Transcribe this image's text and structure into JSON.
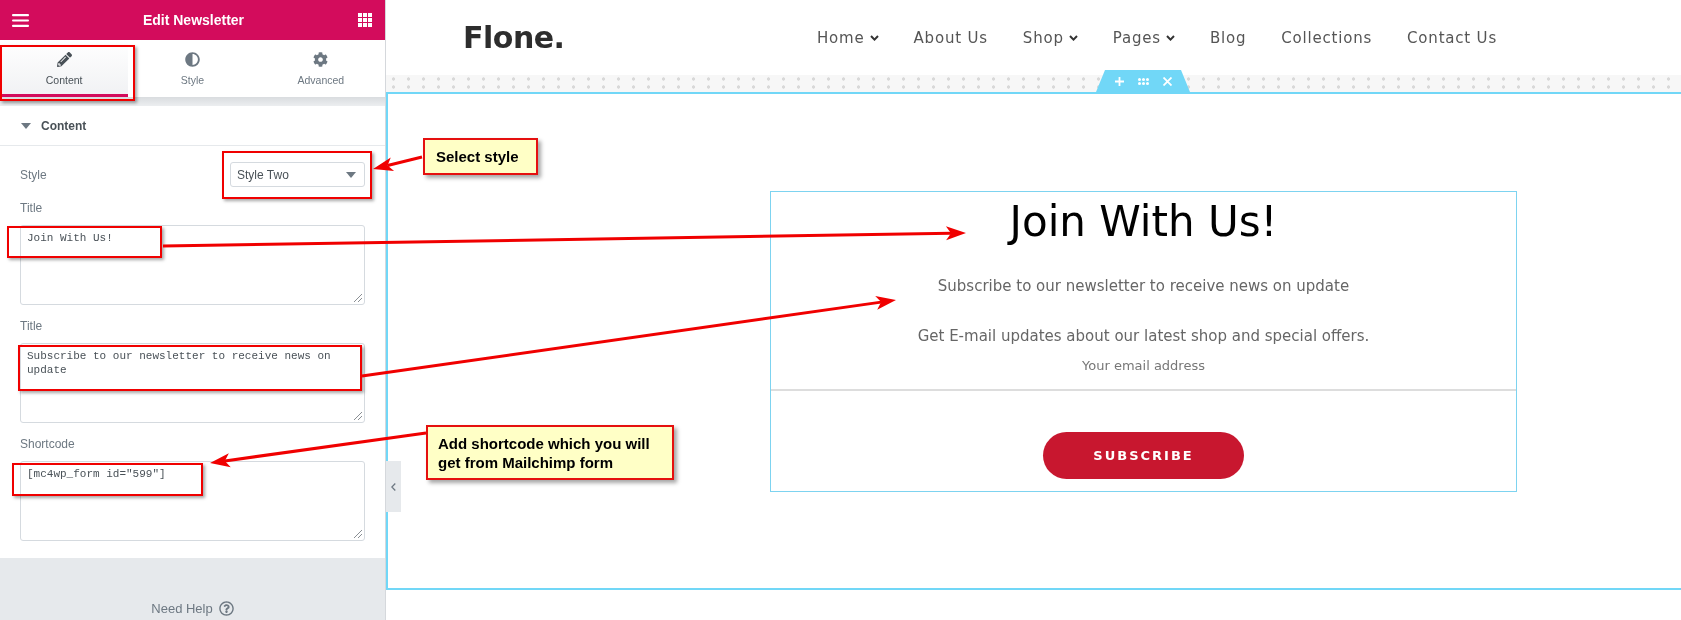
{
  "editor_panel": {
    "title": "Edit Newsletter",
    "tabs": [
      {
        "label": "Content",
        "selected": true
      },
      {
        "label": "Style",
        "selected": false
      },
      {
        "label": "Advanced",
        "selected": false
      }
    ],
    "section": {
      "title": "Content",
      "expanded": true
    },
    "fields": [
      {
        "kind": "select",
        "label": "Style",
        "value": "Style Two"
      },
      {
        "kind": "textarea",
        "label": "Title",
        "value": "Join With Us!"
      },
      {
        "kind": "textarea",
        "label": "Title",
        "value": "Subscribe to our newsletter to receive news on update"
      },
      {
        "kind": "textarea",
        "label": "Shortcode",
        "value": "[mc4wp_form id=\"599\"]"
      }
    ],
    "help": "Need Help"
  },
  "preview": {
    "logo": "Flone.",
    "nav": [
      {
        "label": "Home",
        "dropdown": true
      },
      {
        "label": "About Us",
        "dropdown": false
      },
      {
        "label": "Shop",
        "dropdown": true
      },
      {
        "label": "Pages",
        "dropdown": true
      },
      {
        "label": "Blog",
        "dropdown": false
      },
      {
        "label": "Collections",
        "dropdown": false
      },
      {
        "label": "Contact Us",
        "dropdown": false
      }
    ],
    "newsletter": {
      "title": "Join With Us!",
      "subtitle": "Subscribe to our newsletter to receive news on update",
      "text": "Get E-mail updates about our latest shop and special offers.",
      "email_field": {
        "placeholder": "Your email address"
      },
      "button": "SUBSCRIBE"
    }
  },
  "callouts": [
    {
      "text": "Select style"
    },
    {
      "text": "Add shortcode which you will get from Mailchimp form"
    }
  ]
}
